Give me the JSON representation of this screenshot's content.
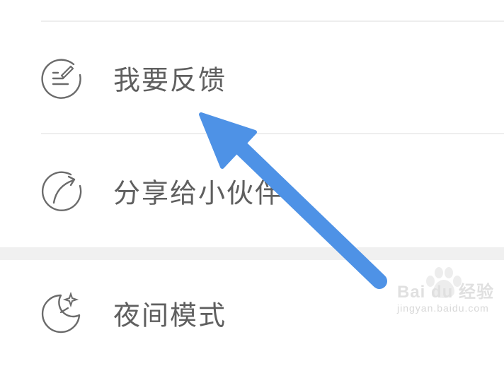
{
  "menu": {
    "items": [
      {
        "label": "我要反馈",
        "icon": "feedback-list-icon"
      },
      {
        "label": "分享给小伙伴",
        "icon": "share-circle-arrow-icon"
      },
      {
        "label": "夜间模式",
        "icon": "moon-star-icon"
      }
    ]
  },
  "watermark": {
    "brand": "Bai du 经验",
    "url": "jingyan.baidu.com"
  },
  "colors": {
    "label": "#5f5f5f",
    "icon": "#6b6b6b",
    "divider": "#eeeeee",
    "section_gap": "#f0f0f0",
    "arrow": "#4e92e6"
  }
}
